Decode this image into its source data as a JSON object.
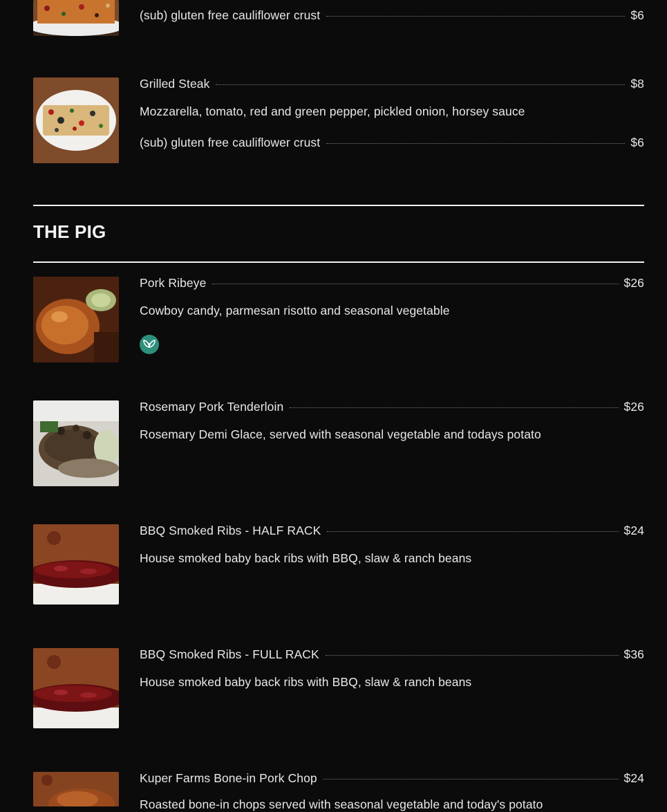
{
  "top_partial": {
    "sub_name": "(sub) gluten free cauliflower crust",
    "sub_price": "$6"
  },
  "grilled_steak": {
    "name": "Grilled Steak",
    "price": "$8",
    "description": "Mozzarella, tomato, red and green pepper, pickled onion, horsey sauce",
    "sub_name": "(sub) gluten free cauliflower crust",
    "sub_price": "$6"
  },
  "section": {
    "title": "THE PIG"
  },
  "items": [
    {
      "name": "Pork Ribeye",
      "price": "$26",
      "description": "Cowboy candy, parmesan risotto and seasonal vegetable",
      "badge_icon": "leaf-icon"
    },
    {
      "name": "Rosemary Pork Tenderloin",
      "price": "$26",
      "description": "Rosemary Demi Glace, served with seasonal vegetable and todays potato"
    },
    {
      "name": "BBQ Smoked Ribs - HALF RACK",
      "price": "$24",
      "description": "House smoked baby back ribs with BBQ, slaw & ranch beans"
    },
    {
      "name": "BBQ Smoked Ribs - FULL RACK",
      "price": "$36",
      "description": "House smoked baby back ribs with BBQ, slaw & ranch beans"
    },
    {
      "name": "Kuper Farms Bone-in Pork Chop",
      "price": "$24",
      "description": "Roasted bone-in chops served with seasonal vegetable and today's potato"
    }
  ],
  "colors": {
    "background": "#0b0b0b",
    "text": "#e8e8e8",
    "rule": "#f2f2f2",
    "badge": "#2d8f7c"
  }
}
